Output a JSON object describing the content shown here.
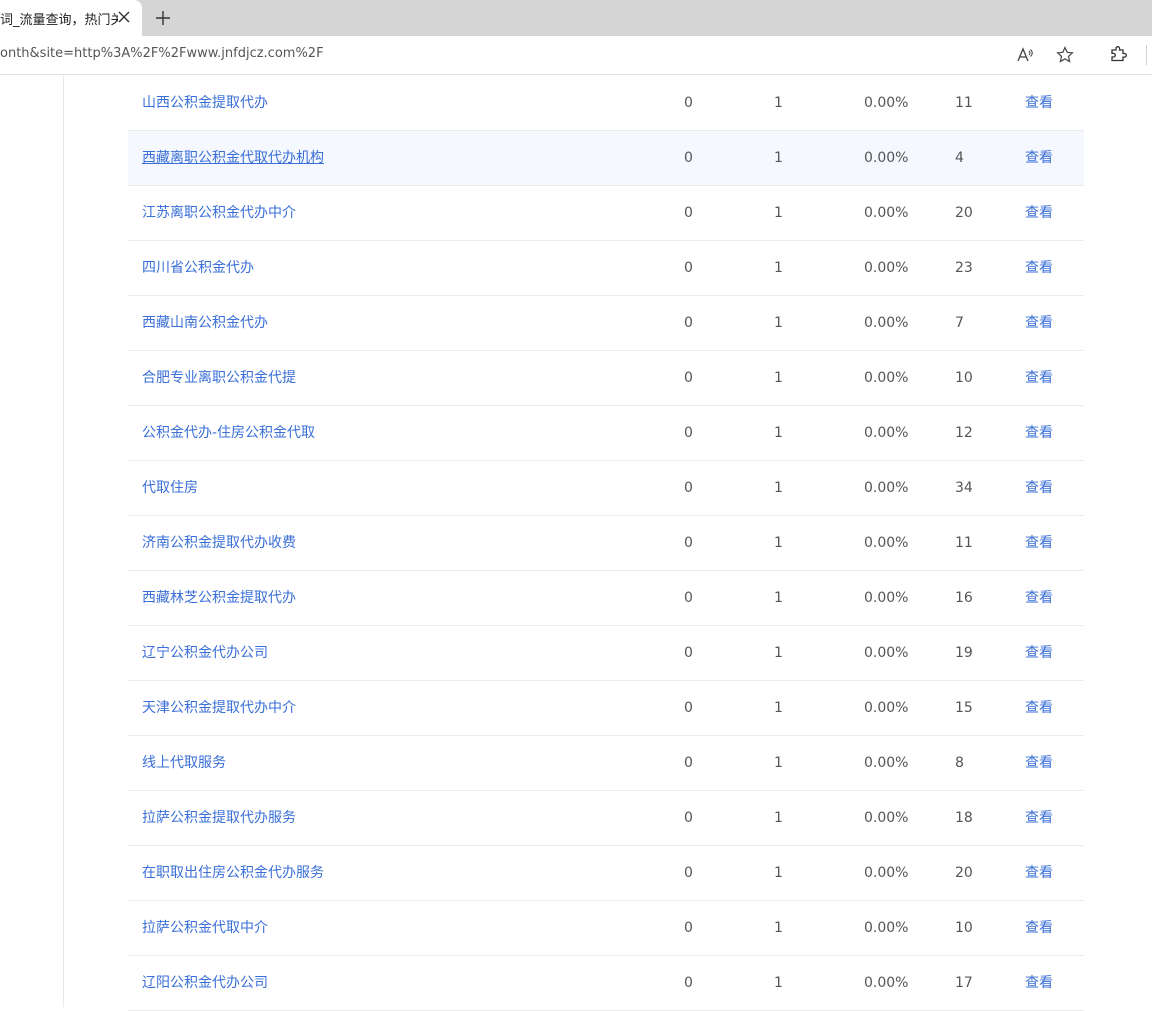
{
  "browser": {
    "tab_title": "词_流量查询，热门关键",
    "url": "onth&site=http%3A%2F%2Fwww.jnfdjcz.com%2F",
    "icons": [
      "close-icon",
      "plus-icon",
      "read-aloud-icon",
      "favorite-star-icon",
      "extensions-icon"
    ]
  },
  "table": {
    "rows": [
      {
        "keyword": "山西公积金提取代办",
        "col2": "0",
        "col3": "1",
        "pct": "0.00%",
        "col5": "11",
        "action": "查看"
      },
      {
        "keyword": "西藏离职公积金代取代办机构",
        "col2": "0",
        "col3": "1",
        "pct": "0.00%",
        "col5": "4",
        "action": "查看"
      },
      {
        "keyword": "江苏离职公积金代办中介",
        "col2": "0",
        "col3": "1",
        "pct": "0.00%",
        "col5": "20",
        "action": "查看"
      },
      {
        "keyword": "四川省公积金代办",
        "col2": "0",
        "col3": "1",
        "pct": "0.00%",
        "col5": "23",
        "action": "查看"
      },
      {
        "keyword": "西藏山南公积金代办",
        "col2": "0",
        "col3": "1",
        "pct": "0.00%",
        "col5": "7",
        "action": "查看"
      },
      {
        "keyword": "合肥专业离职公积金代提",
        "col2": "0",
        "col3": "1",
        "pct": "0.00%",
        "col5": "10",
        "action": "查看"
      },
      {
        "keyword": "公积金代办-住房公积金代取",
        "col2": "0",
        "col3": "1",
        "pct": "0.00%",
        "col5": "12",
        "action": "查看"
      },
      {
        "keyword": "代取住房",
        "col2": "0",
        "col3": "1",
        "pct": "0.00%",
        "col5": "34",
        "action": "查看"
      },
      {
        "keyword": "济南公积金提取代办收费",
        "col2": "0",
        "col3": "1",
        "pct": "0.00%",
        "col5": "11",
        "action": "查看"
      },
      {
        "keyword": "西藏林芝公积金提取代办",
        "col2": "0",
        "col3": "1",
        "pct": "0.00%",
        "col5": "16",
        "action": "查看"
      },
      {
        "keyword": "辽宁公积金代办公司",
        "col2": "0",
        "col3": "1",
        "pct": "0.00%",
        "col5": "19",
        "action": "查看"
      },
      {
        "keyword": "天津公积金提取代办中介",
        "col2": "0",
        "col3": "1",
        "pct": "0.00%",
        "col5": "15",
        "action": "查看"
      },
      {
        "keyword": "线上代取服务",
        "col2": "0",
        "col3": "1",
        "pct": "0.00%",
        "col5": "8",
        "action": "查看"
      },
      {
        "keyword": "拉萨公积金提取代办服务",
        "col2": "0",
        "col3": "1",
        "pct": "0.00%",
        "col5": "18",
        "action": "查看"
      },
      {
        "keyword": "在职取出住房公积金代办服务",
        "col2": "0",
        "col3": "1",
        "pct": "0.00%",
        "col5": "20",
        "action": "查看"
      },
      {
        "keyword": "拉萨公积金代取中介",
        "col2": "0",
        "col3": "1",
        "pct": "0.00%",
        "col5": "10",
        "action": "查看"
      },
      {
        "keyword": "辽阳公积金代办公司",
        "col2": "0",
        "col3": "1",
        "pct": "0.00%",
        "col5": "17",
        "action": "查看"
      }
    ]
  },
  "colors": {
    "link": "#3a6fd8",
    "row_hover": "#f5f8fe",
    "tabstrip": "#d5d5d5"
  }
}
